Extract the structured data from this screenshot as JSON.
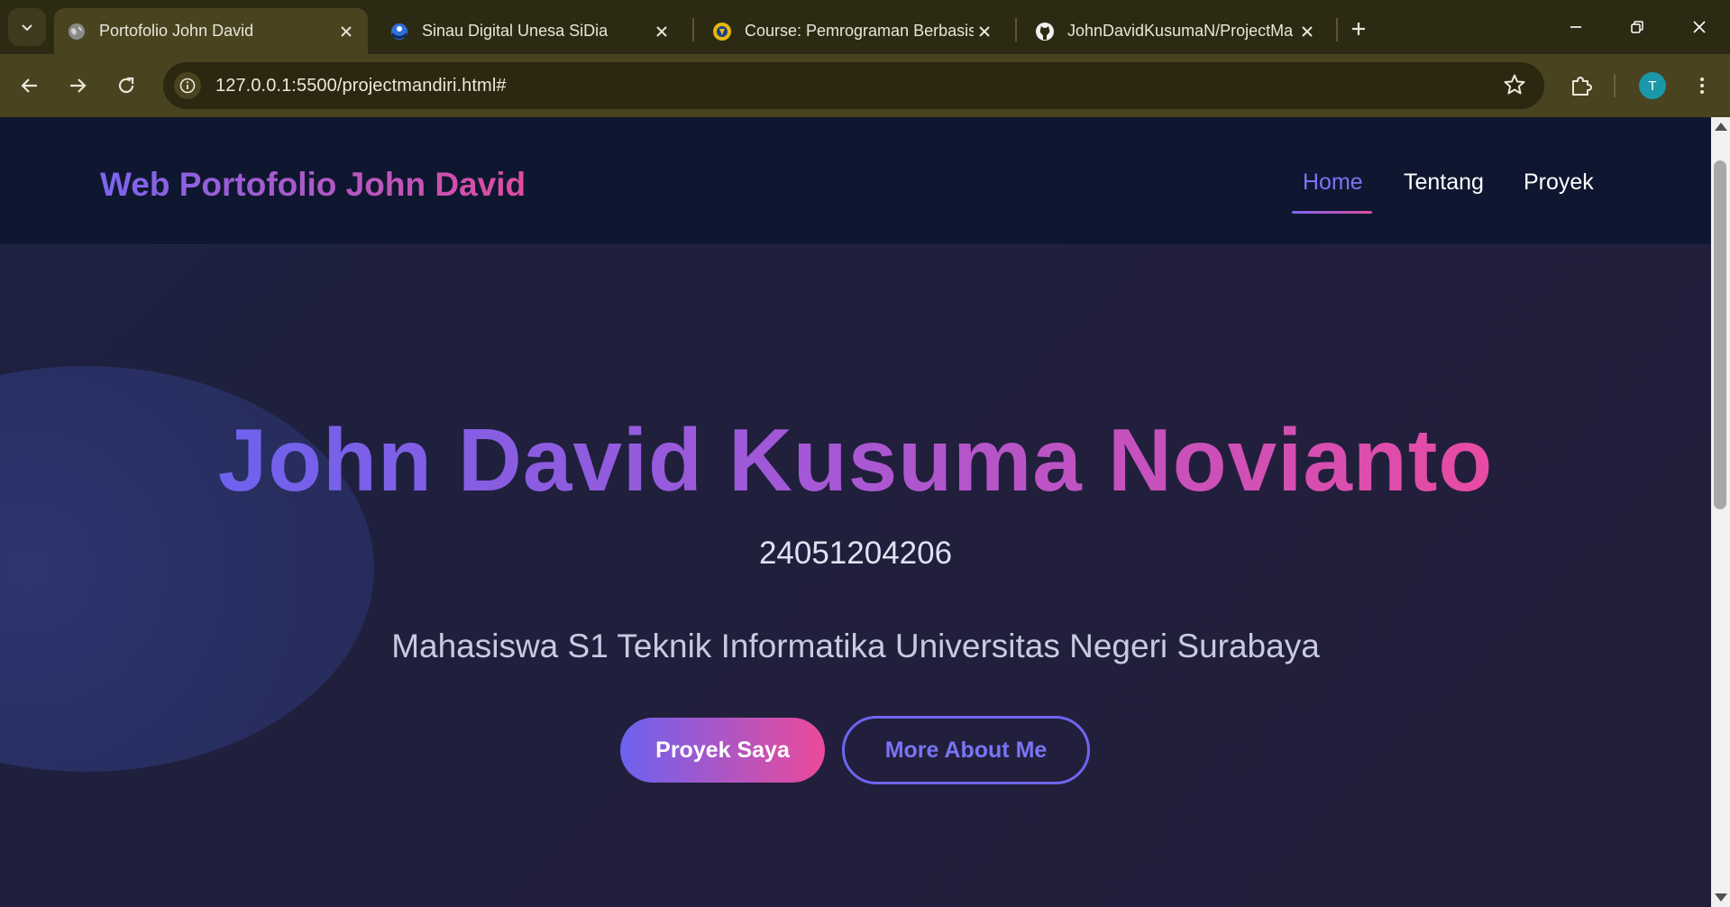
{
  "browser": {
    "tabs": [
      {
        "title": "Portofolio John David",
        "active": true,
        "icon": "globe-icon"
      },
      {
        "title": "Sinau Digital Unesa SiDia",
        "active": false,
        "icon": "sidia-icon"
      },
      {
        "title": "Course: Pemrograman Berbasis",
        "active": false,
        "icon": "unesa-icon"
      },
      {
        "title": "JohnDavidKusumaN/ProjectMa",
        "active": false,
        "icon": "github-icon"
      }
    ],
    "url": "127.0.0.1:5500/projectmandiri.html#",
    "profile_initial": "T",
    "colors": {
      "tabbar": "#2d2a14",
      "toolbar": "#4a4320",
      "avatar": "#1a97a8"
    }
  },
  "site": {
    "brand": "Web Portofolio John David",
    "nav": [
      {
        "label": "Home",
        "active": true
      },
      {
        "label": "Tentang",
        "active": false
      },
      {
        "label": "Proyek",
        "active": false
      }
    ],
    "colors": {
      "navbar": "#0f1730",
      "accent_start": "#6c62ef",
      "accent_end": "#ec4a9a",
      "link_active": "#7a74f5"
    }
  },
  "hero": {
    "name": "John David Kusuma Novianto",
    "nim": "24051204206",
    "description": "Mahasiswa S1 Teknik Informatika Universitas Negeri Surabaya",
    "primary_button": "Proyek Saya",
    "secondary_button": "More About Me"
  }
}
